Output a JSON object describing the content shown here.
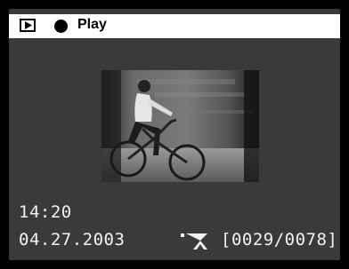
{
  "header": {
    "mode_label": "Play",
    "play_mode_icon": "play-mode-icon",
    "record_icon": "record-dot-icon"
  },
  "image": {
    "description_icon": "photo-thumbnail"
  },
  "info": {
    "time": "14:20",
    "date": "04.27.2003",
    "counter": "[0029/0078]",
    "movie_icon": "movie-camera-icon"
  }
}
